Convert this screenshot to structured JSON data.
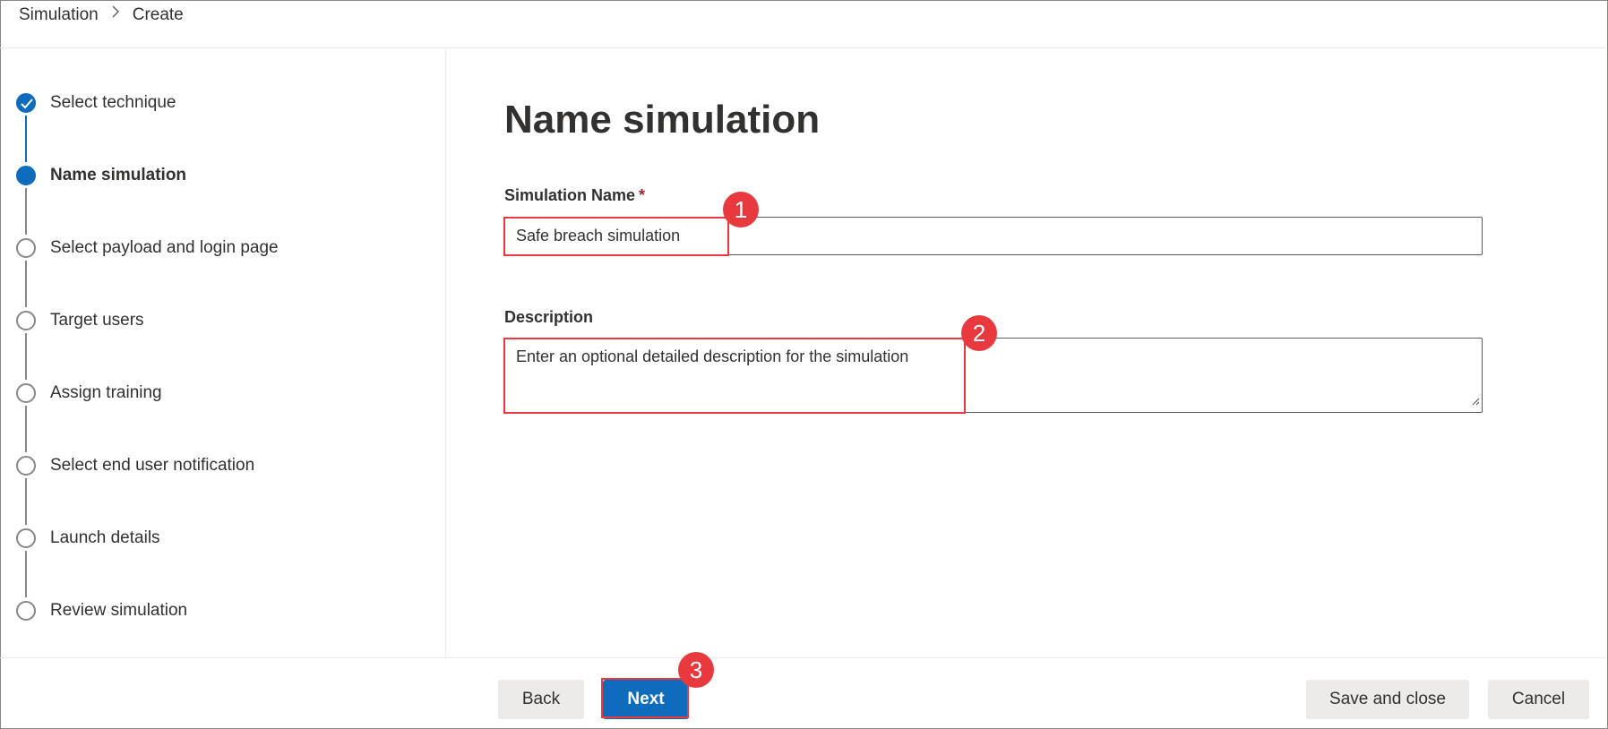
{
  "breadcrumb": {
    "items": [
      "Simulation",
      "Create"
    ]
  },
  "stepper": {
    "steps": [
      {
        "label": "Select technique",
        "state": "done"
      },
      {
        "label": "Name simulation",
        "state": "current"
      },
      {
        "label": "Select payload and login page",
        "state": "pending"
      },
      {
        "label": "Target users",
        "state": "pending"
      },
      {
        "label": "Assign training",
        "state": "pending"
      },
      {
        "label": "Select end user notification",
        "state": "pending"
      },
      {
        "label": "Launch details",
        "state": "pending"
      },
      {
        "label": "Review simulation",
        "state": "pending"
      }
    ]
  },
  "form": {
    "title": "Name simulation",
    "name_label": "Simulation Name",
    "required_marker": "*",
    "name_value": "Safe breach simulation",
    "description_label": "Description",
    "description_placeholder": "Enter an optional detailed description for the simulation"
  },
  "annotations": [
    "1",
    "2",
    "3"
  ],
  "footer": {
    "back_label": "Back",
    "next_label": "Next",
    "save_label": "Save and close",
    "cancel_label": "Cancel"
  },
  "colors": {
    "accent": "#0f6cbd",
    "annotation": "#e8393f",
    "required": "#a4262c"
  },
  "icons": {
    "breadcrumb_separator": "chevron-right-icon",
    "step_done": "checkmark-icon"
  }
}
